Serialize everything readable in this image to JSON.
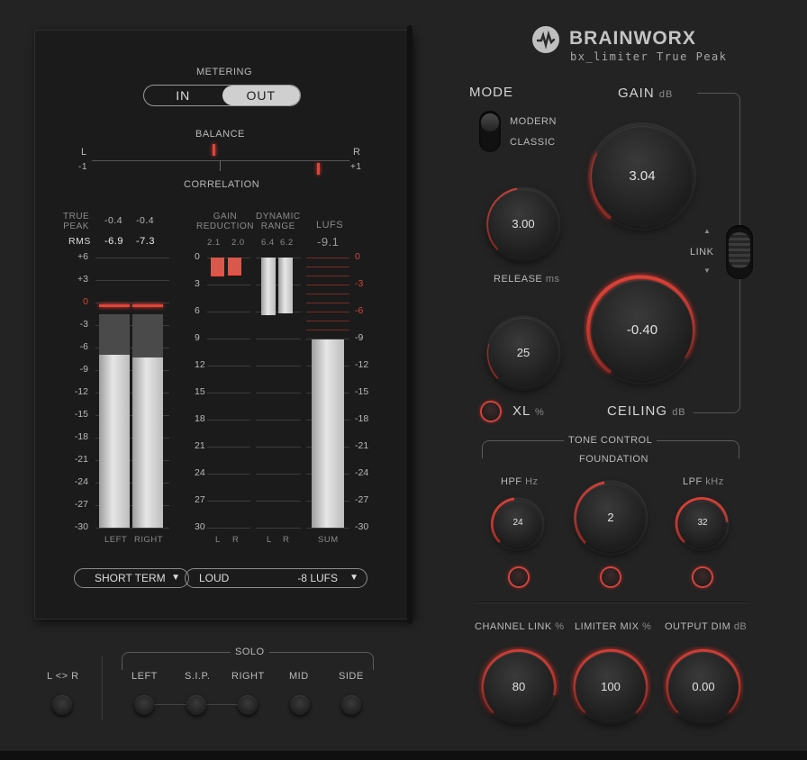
{
  "brand": {
    "name": "BRAINWORX",
    "product": "bx_limiter True Peak"
  },
  "metering": {
    "label": "METERING",
    "options": [
      "IN",
      "OUT"
    ],
    "selected": "OUT"
  },
  "balance": {
    "label": "BALANCE",
    "left": "L",
    "right": "R",
    "min": "-1",
    "max": "+1",
    "corr_label": "CORRELATION"
  },
  "peak": {
    "true_peak_label": "TRUE\nPEAK",
    "rms_label": "RMS",
    "tp_left": "-0.4",
    "tp_right": "-0.4",
    "rms_left": "-6.9",
    "rms_right": "-7.3",
    "level_left_db": -6.9,
    "level_right_db": -7.3,
    "hold_left_db": -0.4,
    "hold_right_db": -0.4
  },
  "scale_left": [
    "+6",
    "+3",
    "0",
    "-3",
    "-6",
    "-9",
    "-12",
    "-15",
    "-18",
    "-21",
    "-24",
    "-27",
    "-30"
  ],
  "gr": {
    "label": "GAIN\nREDUCTION",
    "left": "2.1",
    "right": "2.0",
    "left_db": 2.1,
    "right_db": 2.0
  },
  "dr": {
    "label": "DYNAMIC\nRANGE",
    "left": "6.4",
    "right": "6.2",
    "left_db": 6.4,
    "right_db": 6.2
  },
  "scale_mid": [
    "0",
    "3",
    "6",
    "9",
    "12",
    "15",
    "18",
    "21",
    "24",
    "27",
    "30"
  ],
  "lufs": {
    "label": "LUFS",
    "value": "-9.1",
    "value_db": -9.1
  },
  "scale_right": [
    "0",
    "-3",
    "-6",
    "-9",
    "-12",
    "-15",
    "-18",
    "-21",
    "-24",
    "-27",
    "-30"
  ],
  "meter_footer": {
    "left": "LEFT",
    "right": "RIGHT",
    "l": "L",
    "r": "R",
    "l2": "L",
    "r2": "R",
    "sum": "SUM"
  },
  "dropdowns": {
    "mode": "SHORT TERM",
    "preset": "LOUD",
    "target": "-8 LUFS"
  },
  "mode": {
    "label": "MODE",
    "opt1": "MODERN",
    "opt2": "CLASSIC",
    "selected": "MODERN"
  },
  "gain": {
    "label": "GAIN",
    "unit": "dB",
    "value": "3.04"
  },
  "knob_small": {
    "value": "3.00"
  },
  "release": {
    "label": "RELEASE",
    "unit": "ms",
    "value": "25"
  },
  "link": {
    "label": "LINK"
  },
  "ceiling": {
    "label": "CEILING",
    "unit": "dB",
    "value": "-0.40"
  },
  "xl": {
    "label": "XL",
    "unit": "%"
  },
  "tone": {
    "label": "TONE CONTROL",
    "foundation": "FOUNDATION",
    "foundation_value": "2",
    "hpf_label": "HPF",
    "hpf_unit": "Hz",
    "hpf_value": "24",
    "lpf_label": "LPF",
    "lpf_unit": "kHz",
    "lpf_value": "32"
  },
  "bottom": {
    "ch_link_label": "CHANNEL LINK",
    "ch_link_unit": "%",
    "ch_link_value": "80",
    "mix_label": "LIMITER MIX",
    "mix_unit": "%",
    "mix_value": "100",
    "out_label": "OUTPUT DIM",
    "out_unit": "dB",
    "out_value": "0.00"
  },
  "solo": {
    "label": "SOLO",
    "lr": "L <> R",
    "items": [
      "LEFT",
      "S.I.P.",
      "RIGHT",
      "MID",
      "SIDE"
    ]
  },
  "colors": {
    "accent": "#e0443a",
    "bg": "#232323",
    "panel": "#1b1b1b"
  }
}
